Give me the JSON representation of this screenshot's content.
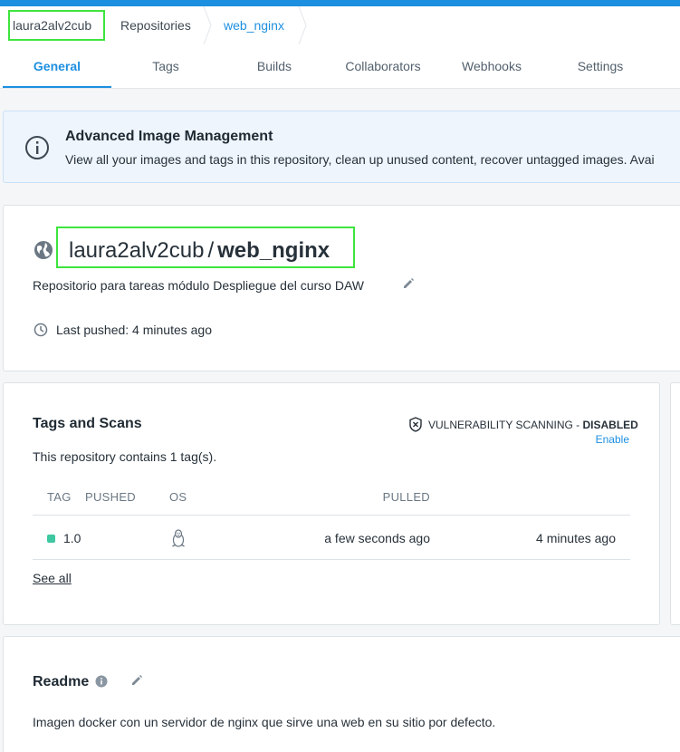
{
  "breadcrumb": {
    "items": [
      "laura2alv2cub",
      "Repositories",
      "web_nginx"
    ]
  },
  "tabs": [
    "General",
    "Tags",
    "Builds",
    "Collaborators",
    "Webhooks",
    "Settings"
  ],
  "banner": {
    "title": "Advanced Image Management",
    "text": "View all your images and tags in this repository, clean up unused content, recover untagged images. Avai"
  },
  "repo": {
    "namespace": "laura2alv2cub",
    "separator": "/",
    "name": "web_nginx",
    "description": "Repositorio para tareas módulo Despliegue del curso DAW",
    "last_pushed": "Last pushed: 4 minutes ago"
  },
  "tags_section": {
    "title": "Tags and Scans",
    "vuln_label": "VULNERABILITY SCANNING - ",
    "vuln_status": "DISABLED",
    "enable_link": "Enable",
    "count_text": "This repository contains 1 tag(s).",
    "columns": [
      "TAG",
      "OS",
      "PULLED",
      "PUSHED"
    ],
    "rows": [
      {
        "tag": "1.0",
        "os": "linux-icon",
        "pulled": "a few seconds ago",
        "pushed": "4 minutes ago"
      }
    ],
    "see_all": "See all"
  },
  "readme": {
    "title": "Readme",
    "text": "Imagen docker con un servidor de nginx que sirve una web en su sitio por defecto."
  },
  "colors": {
    "accent": "#1d8fe0",
    "highlight": "#3ee43e",
    "tag_dot": "#3ec7a0"
  }
}
